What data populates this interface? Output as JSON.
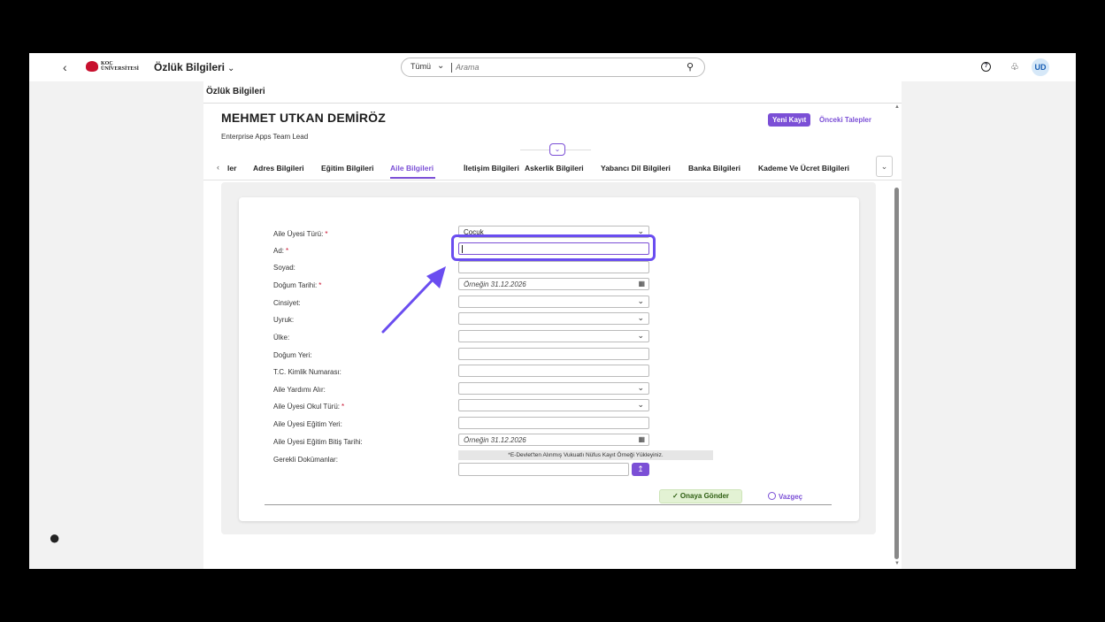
{
  "shell": {
    "back_icon": "chevron-left-icon",
    "logo_text_line1": "KOÇ",
    "logo_text_line2": "ÜNİVERSİTESİ",
    "app_title": "Özlük Bilgileri",
    "search_scope": "Tümü",
    "search_placeholder": "Arama",
    "avatar_initials": "UD"
  },
  "page": {
    "title": "Özlük Bilgileri",
    "employee_name": "MEHMET UTKAN DEMİRÖZ",
    "employee_role": "Enterprise Apps Team Lead",
    "new_record_label": "Yeni Kayıt",
    "previous_requests_label": "Önceki Talepler"
  },
  "tabs": [
    {
      "label": "ler"
    },
    {
      "label": "Adres Bilgileri"
    },
    {
      "label": "Eğitim Bilgileri"
    },
    {
      "label": "Aile Bilgileri",
      "active": true
    },
    {
      "label": "İletişim Bilgileri"
    },
    {
      "label": "Askerlik Bilgileri"
    },
    {
      "label": "Yabancı Dil Bilgileri"
    },
    {
      "label": "Banka Bilgileri"
    },
    {
      "label": "Kademe Ve Ücret Bilgileri"
    }
  ],
  "form": {
    "fields": [
      {
        "label": "Aile Üyesi Türü:",
        "required": true,
        "type": "select",
        "value": "Çocuk"
      },
      {
        "label": "Ad:",
        "required": true,
        "type": "text",
        "value": ""
      },
      {
        "label": "Soyad:",
        "required": false,
        "type": "text",
        "value": ""
      },
      {
        "label": "Doğum Tarihi:",
        "required": true,
        "type": "date",
        "placeholder": "Örneğin 31.12.2026"
      },
      {
        "label": "Cinsiyet:",
        "required": false,
        "type": "select",
        "value": ""
      },
      {
        "label": "Uyruk:",
        "required": false,
        "type": "select",
        "value": ""
      },
      {
        "label": "Ülke:",
        "required": false,
        "type": "select",
        "value": ""
      },
      {
        "label": "Doğum Yeri:",
        "required": false,
        "type": "text",
        "value": ""
      },
      {
        "label": "T.C. Kimlik Numarası:",
        "required": false,
        "type": "text",
        "value": ""
      },
      {
        "label": "Aile Yardımı Alır:",
        "required": false,
        "type": "select",
        "value": ""
      },
      {
        "label": "Aile Üyesi Okul Türü:",
        "required": true,
        "type": "select",
        "value": ""
      },
      {
        "label": "Aile Üyesi Eğitim Yeri:",
        "required": false,
        "type": "text",
        "value": ""
      },
      {
        "label": "Aile Üyesi Eğitim Bitiş Tarihi:",
        "required": false,
        "type": "date",
        "placeholder": "Örneğin 31.12.2026"
      }
    ],
    "documents_label": "Gerekli Dokümanlar:",
    "documents_hint": "*E-Devlet'ten Alınmış Vukuatlı Nüfus Kayıt Örneği Yükleyiniz.",
    "submit_label": "Onaya Gönder",
    "cancel_label": "Vazgeç"
  },
  "colors": {
    "accent": "#7b4fd6",
    "highlight": "#6a4df0",
    "required": "#c8102e",
    "submit_bg": "#e3f2d4"
  }
}
